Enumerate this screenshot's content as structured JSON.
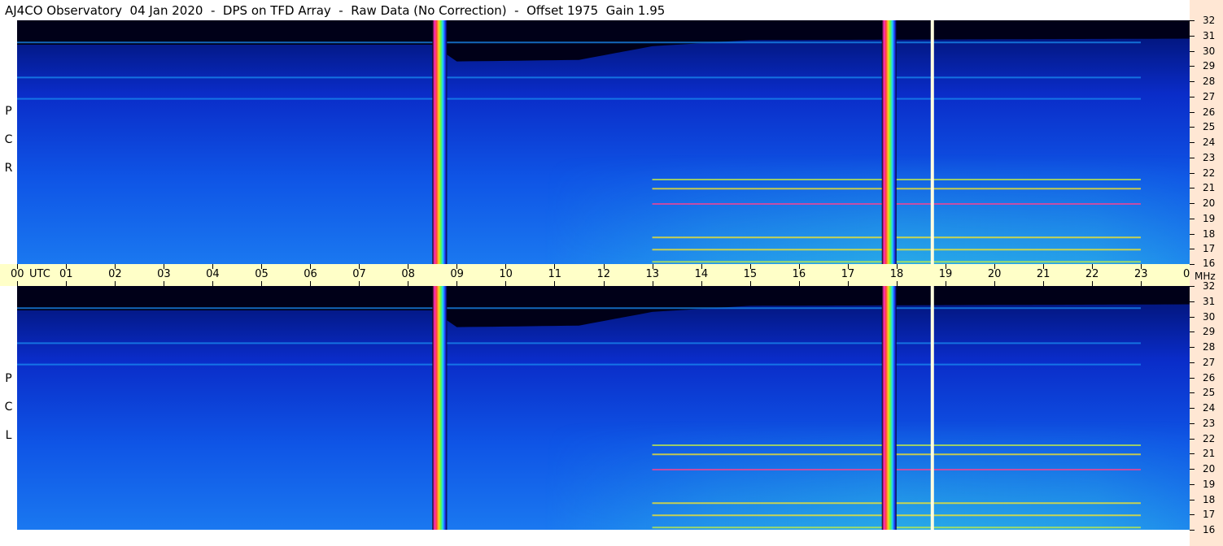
{
  "title": "AJ4CO Observatory  04 Jan 2020  -  DPS on TFD Array  -  Raw Data (No Correction)  -  Offset 1975  Gain 1.95",
  "panels": [
    {
      "id": "rcp",
      "label_letters": [
        "R",
        "C",
        "P"
      ]
    },
    {
      "id": "lcp",
      "label_letters": [
        "L",
        "C",
        "P"
      ]
    }
  ],
  "chart_data": {
    "type": "heatmap",
    "title": "AJ4CO Observatory  04 Jan 2020  -  DPS on TFD Array  -  Raw Data (No Correction)  -  Offset 1975  Gain 1.95",
    "x_axis": {
      "unit_label": "UTC",
      "range_hours": [
        0,
        24
      ],
      "tick_labels": [
        "00",
        "01",
        "02",
        "03",
        "04",
        "05",
        "06",
        "07",
        "08",
        "09",
        "10",
        "11",
        "12",
        "13",
        "14",
        "15",
        "16",
        "17",
        "18",
        "19",
        "20",
        "21",
        "22",
        "23",
        "00"
      ]
    },
    "y_axis": {
      "unit_label": "MHz",
      "range_mhz": [
        16,
        32
      ],
      "tick_labels": [
        "32",
        "31",
        "30",
        "29",
        "28",
        "27",
        "26",
        "25",
        "24",
        "23",
        "22",
        "21",
        "20",
        "19",
        "18",
        "17",
        "16"
      ]
    },
    "colormap": [
      "#000018",
      "#00106a",
      "#0a3ad8",
      "#1a8cf0",
      "#33d2e0",
      "#c8f040",
      "#ffea20",
      "#ff4090"
    ],
    "calibration_bands_utc": [
      {
        "start": 8.5,
        "end": 8.8
      },
      {
        "start": 17.7,
        "end": 18.0
      }
    ],
    "white_band_utc": 18.7,
    "top_cutoff_mhz_by_hour": [
      [
        0,
        30.4
      ],
      [
        8.5,
        30.4
      ],
      [
        9,
        29.3
      ],
      [
        11.5,
        29.4
      ],
      [
        13,
        30.3
      ],
      [
        15,
        30.7
      ],
      [
        24,
        30.8
      ]
    ],
    "persistent_signals_mhz": [
      30.6,
      28.3,
      26.9,
      21.6,
      21.0,
      20.0,
      17.8,
      17.0,
      16.2
    ]
  }
}
